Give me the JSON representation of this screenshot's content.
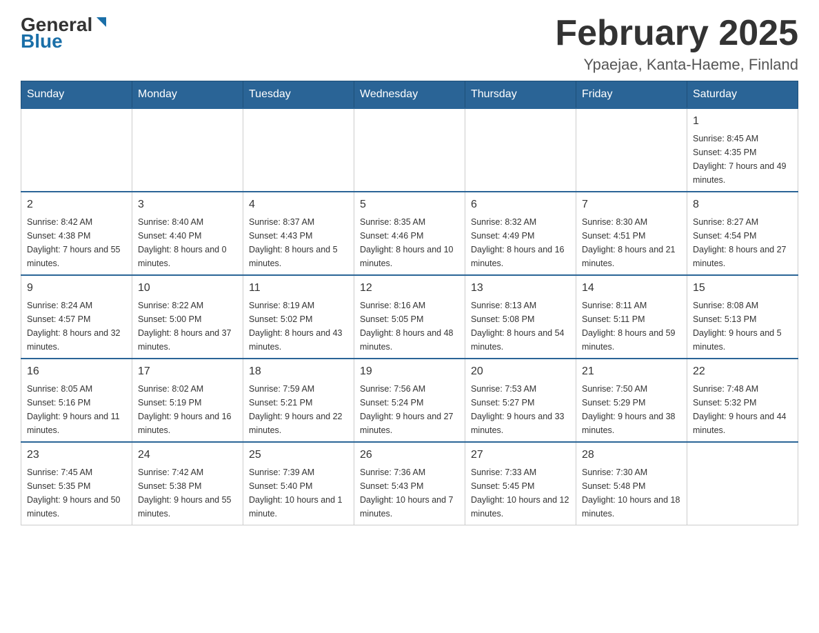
{
  "header": {
    "logo_general": "General",
    "logo_blue": "Blue",
    "title": "February 2025",
    "subtitle": "Ypaejae, Kanta-Haeme, Finland"
  },
  "days_of_week": [
    "Sunday",
    "Monday",
    "Tuesday",
    "Wednesday",
    "Thursday",
    "Friday",
    "Saturday"
  ],
  "weeks": [
    [
      {
        "day": "",
        "info": ""
      },
      {
        "day": "",
        "info": ""
      },
      {
        "day": "",
        "info": ""
      },
      {
        "day": "",
        "info": ""
      },
      {
        "day": "",
        "info": ""
      },
      {
        "day": "",
        "info": ""
      },
      {
        "day": "1",
        "info": "Sunrise: 8:45 AM\nSunset: 4:35 PM\nDaylight: 7 hours and 49 minutes."
      }
    ],
    [
      {
        "day": "2",
        "info": "Sunrise: 8:42 AM\nSunset: 4:38 PM\nDaylight: 7 hours and 55 minutes."
      },
      {
        "day": "3",
        "info": "Sunrise: 8:40 AM\nSunset: 4:40 PM\nDaylight: 8 hours and 0 minutes."
      },
      {
        "day": "4",
        "info": "Sunrise: 8:37 AM\nSunset: 4:43 PM\nDaylight: 8 hours and 5 minutes."
      },
      {
        "day": "5",
        "info": "Sunrise: 8:35 AM\nSunset: 4:46 PM\nDaylight: 8 hours and 10 minutes."
      },
      {
        "day": "6",
        "info": "Sunrise: 8:32 AM\nSunset: 4:49 PM\nDaylight: 8 hours and 16 minutes."
      },
      {
        "day": "7",
        "info": "Sunrise: 8:30 AM\nSunset: 4:51 PM\nDaylight: 8 hours and 21 minutes."
      },
      {
        "day": "8",
        "info": "Sunrise: 8:27 AM\nSunset: 4:54 PM\nDaylight: 8 hours and 27 minutes."
      }
    ],
    [
      {
        "day": "9",
        "info": "Sunrise: 8:24 AM\nSunset: 4:57 PM\nDaylight: 8 hours and 32 minutes."
      },
      {
        "day": "10",
        "info": "Sunrise: 8:22 AM\nSunset: 5:00 PM\nDaylight: 8 hours and 37 minutes."
      },
      {
        "day": "11",
        "info": "Sunrise: 8:19 AM\nSunset: 5:02 PM\nDaylight: 8 hours and 43 minutes."
      },
      {
        "day": "12",
        "info": "Sunrise: 8:16 AM\nSunset: 5:05 PM\nDaylight: 8 hours and 48 minutes."
      },
      {
        "day": "13",
        "info": "Sunrise: 8:13 AM\nSunset: 5:08 PM\nDaylight: 8 hours and 54 minutes."
      },
      {
        "day": "14",
        "info": "Sunrise: 8:11 AM\nSunset: 5:11 PM\nDaylight: 8 hours and 59 minutes."
      },
      {
        "day": "15",
        "info": "Sunrise: 8:08 AM\nSunset: 5:13 PM\nDaylight: 9 hours and 5 minutes."
      }
    ],
    [
      {
        "day": "16",
        "info": "Sunrise: 8:05 AM\nSunset: 5:16 PM\nDaylight: 9 hours and 11 minutes."
      },
      {
        "day": "17",
        "info": "Sunrise: 8:02 AM\nSunset: 5:19 PM\nDaylight: 9 hours and 16 minutes."
      },
      {
        "day": "18",
        "info": "Sunrise: 7:59 AM\nSunset: 5:21 PM\nDaylight: 9 hours and 22 minutes."
      },
      {
        "day": "19",
        "info": "Sunrise: 7:56 AM\nSunset: 5:24 PM\nDaylight: 9 hours and 27 minutes."
      },
      {
        "day": "20",
        "info": "Sunrise: 7:53 AM\nSunset: 5:27 PM\nDaylight: 9 hours and 33 minutes."
      },
      {
        "day": "21",
        "info": "Sunrise: 7:50 AM\nSunset: 5:29 PM\nDaylight: 9 hours and 38 minutes."
      },
      {
        "day": "22",
        "info": "Sunrise: 7:48 AM\nSunset: 5:32 PM\nDaylight: 9 hours and 44 minutes."
      }
    ],
    [
      {
        "day": "23",
        "info": "Sunrise: 7:45 AM\nSunset: 5:35 PM\nDaylight: 9 hours and 50 minutes."
      },
      {
        "day": "24",
        "info": "Sunrise: 7:42 AM\nSunset: 5:38 PM\nDaylight: 9 hours and 55 minutes."
      },
      {
        "day": "25",
        "info": "Sunrise: 7:39 AM\nSunset: 5:40 PM\nDaylight: 10 hours and 1 minute."
      },
      {
        "day": "26",
        "info": "Sunrise: 7:36 AM\nSunset: 5:43 PM\nDaylight: 10 hours and 7 minutes."
      },
      {
        "day": "27",
        "info": "Sunrise: 7:33 AM\nSunset: 5:45 PM\nDaylight: 10 hours and 12 minutes."
      },
      {
        "day": "28",
        "info": "Sunrise: 7:30 AM\nSunset: 5:48 PM\nDaylight: 10 hours and 18 minutes."
      },
      {
        "day": "",
        "info": ""
      }
    ]
  ]
}
